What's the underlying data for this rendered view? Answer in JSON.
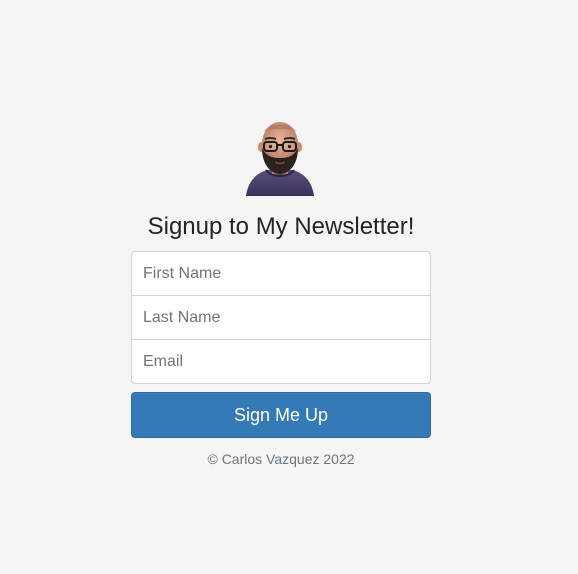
{
  "avatar": {
    "icon": "bearded-man-avatar-icon"
  },
  "heading": "Signup to My Newsletter!",
  "form": {
    "first_name_placeholder": "First Name",
    "last_name_placeholder": "Last Name",
    "email_placeholder": "Email",
    "submit_label": "Sign Me Up"
  },
  "footer": "© Carlos Vazquez 2022",
  "colors": {
    "background": "#f5f5f5",
    "button": "#337ab7",
    "border": "#ced4da"
  }
}
